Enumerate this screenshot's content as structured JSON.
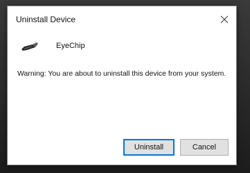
{
  "dialog": {
    "title": "Uninstall Device",
    "close_icon": "close-icon",
    "device": {
      "icon": "usb-device-icon",
      "name": "EyeChip"
    },
    "warning_text": "Warning: You are about to uninstall this device from your system.",
    "buttons": {
      "uninstall_label": "Uninstall",
      "cancel_label": "Cancel"
    }
  },
  "colors": {
    "primary_button_border": "#0078d7",
    "button_background": "#e1e1e1"
  }
}
